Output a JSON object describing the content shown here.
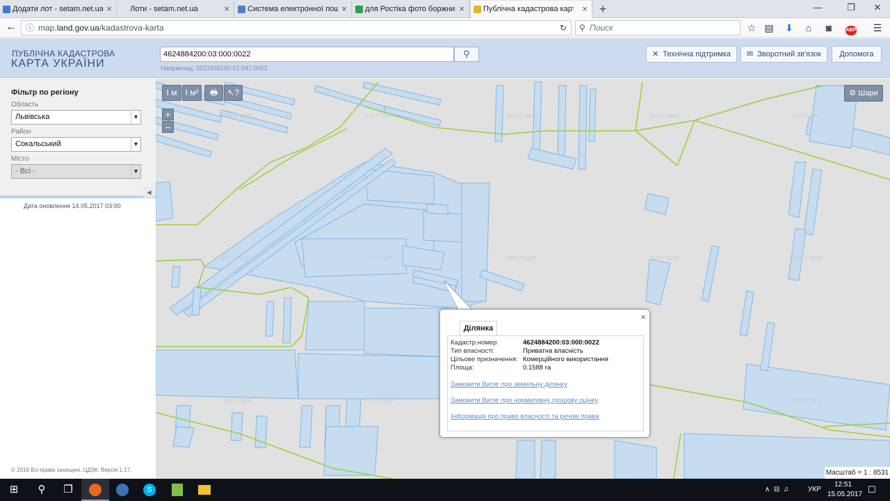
{
  "browser": {
    "tabs": [
      {
        "title": "Додати лот - setam.net.ua",
        "icon_color": "#3a7bd5",
        "active": false
      },
      {
        "title": "Лоти - setam.net.ua",
        "icon_color": "#3a7bd5",
        "active": false
      },
      {
        "title": "Система електронної пош",
        "icon_color": "#4b7fc1",
        "active": false
      },
      {
        "title": "для Ростіка фото боржник",
        "icon_color": "#2f9e4f",
        "active": false
      },
      {
        "title": "Публічна кадастрова карта",
        "icon_color": "#e3b72a",
        "active": true
      }
    ],
    "url_prefix": "map.",
    "url_domain": "land.gov.ua",
    "url_path": "/kadastrova-karta",
    "search_placeholder": "Поиск"
  },
  "header": {
    "logo_line1": "ПУБЛІЧНА КАДАСТРОВА",
    "logo_line2": "КАРТА УКРАЇНИ",
    "cadastral_input_value": "4624884200:03:000:0022",
    "example_text": "Наприклад: 3221655100:01:047:0052",
    "buttons": {
      "support": "Технічна підтримка",
      "feedback": "Зворотний зв'язок",
      "help": "Допомога"
    }
  },
  "sidebar": {
    "filter_title": "Фільтр по регіону",
    "region_label": "Область",
    "region_value": "Львівська",
    "district_label": "Район",
    "district_value": "Сокальський",
    "city_label": "Місто",
    "city_value": "- Всі -",
    "update_date": "Дата оновлення  14.05.2017 03:00",
    "copyright": "© 2016 Всі права захищені. ЦДЗК. Версія 1.17."
  },
  "map": {
    "tools": [
      "I м",
      "I м²",
      "🖶",
      "↖?"
    ],
    "zoom_in": "+",
    "zoom_out": "–",
    "layers_label": "Шари",
    "watermark": "2015 © ЦДЗК",
    "scale_text": "Масштаб = 1 : 8531",
    "colors": {
      "parcel_fill": "#c8dcef",
      "parcel_stroke": "#7fb8e6",
      "boundary": "#9ccf3a",
      "background": "#e1e1e1"
    }
  },
  "popup": {
    "tab_label": "Ділянка",
    "rows": [
      {
        "label": "Кадастр.номер:",
        "value": "4624884200:03:000:0022",
        "bold": true
      },
      {
        "label": "Тип власності:",
        "value": "Приватна власність"
      },
      {
        "label": "Цільове призначення:",
        "value": "Комерційного використання"
      },
      {
        "label": "Площа:",
        "value": "0.1588 га"
      }
    ],
    "links": [
      "Замовити Витяг про земельну ділянку",
      "Замовити Витяг про нормативну грошову оцінку",
      "Інформація про право власності та речові права"
    ]
  },
  "taskbar": {
    "language": "УКР",
    "time": "12:51",
    "date": "15.05.2017"
  }
}
